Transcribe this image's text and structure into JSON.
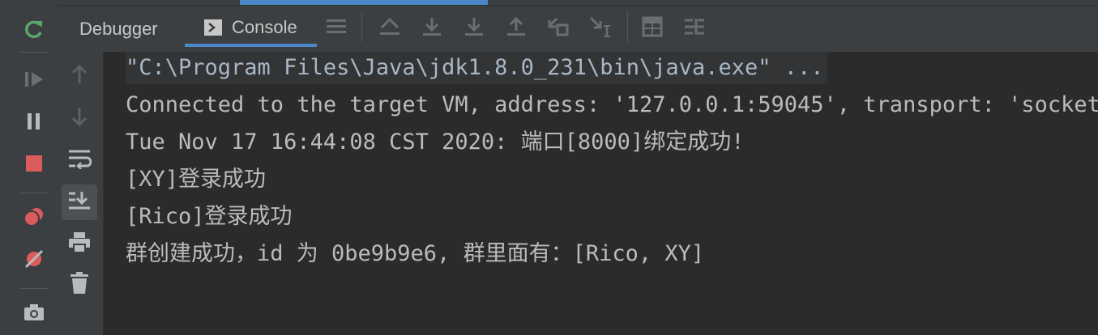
{
  "left_edge": {
    "text": "..."
  },
  "left_toolbar": {
    "items": [
      {
        "name": "rerun-icon"
      },
      {
        "name": "resume-icon"
      },
      {
        "name": "pause-icon"
      },
      {
        "name": "stop-icon"
      },
      {
        "name": "view-breakpoints-icon"
      },
      {
        "name": "mute-breakpoints-icon"
      },
      {
        "name": "camera-icon"
      }
    ]
  },
  "tabs": {
    "debugger_label": "Debugger",
    "console_label": "Console"
  },
  "toolbar_icons": [
    "threads-list-icon",
    "show-execution-point-icon",
    "step-over-icon",
    "step-into-icon",
    "step-out-icon",
    "drop-frame-icon",
    "run-to-cursor-icon",
    "evaluate-expression-icon",
    "trace-icon"
  ],
  "gutter_icons": [
    "up-arrow-icon",
    "down-arrow-icon",
    "soft-wrap-icon",
    "scroll-to-end-icon",
    "print-icon",
    "clear-all-icon"
  ],
  "console": {
    "lines": [
      "\"C:\\Program Files\\Java\\jdk1.8.0_231\\bin\\java.exe\" ...",
      "Connected to the target VM, address: '127.0.0.1:59045', transport: 'socket'",
      "Tue Nov 17 16:44:08 CST 2020: 端口[8000]绑定成功!",
      "[XY]登录成功",
      "[Rico]登录成功",
      "群创建成功，id 为 0be9b9e6, 群里面有：[Rico, XY]"
    ]
  },
  "colors": {
    "background": "#2b2b2b",
    "panel": "#3c3f41",
    "accent": "#4a88c7",
    "text": "#bbbbbb",
    "rerun": "#59a869",
    "stop": "#db5c5c"
  }
}
